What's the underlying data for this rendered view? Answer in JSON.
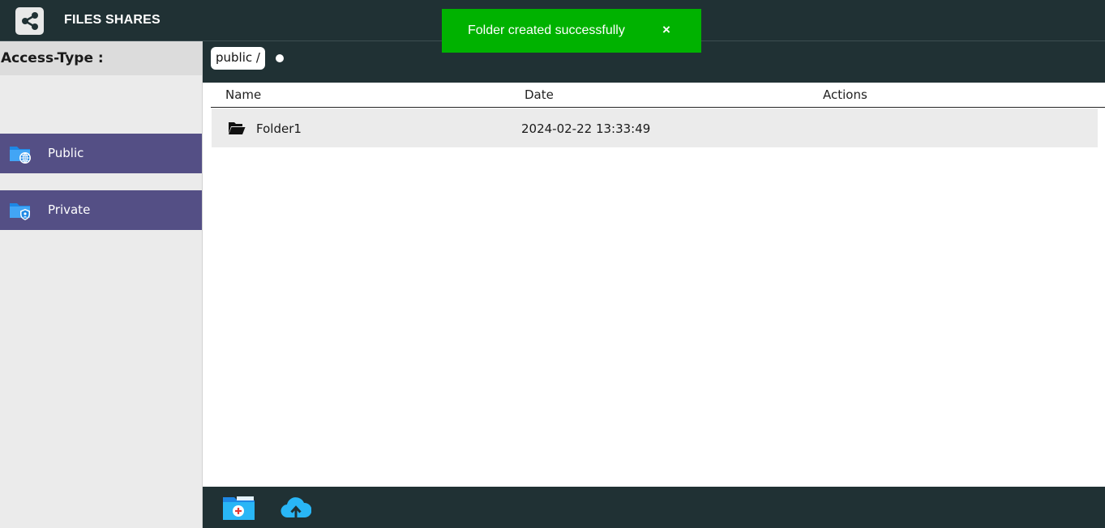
{
  "app": {
    "title": "FILES SHARES",
    "logo_icon": "share-icon"
  },
  "toast": {
    "message": "Folder created successfully",
    "close": "×",
    "color": "#00b200"
  },
  "sidebar": {
    "header": "Access-Type :",
    "items": [
      {
        "label": "Public",
        "icon": "folder-globe-icon"
      },
      {
        "label": "Private",
        "icon": "folder-lock-icon"
      }
    ],
    "accent": "#544f85"
  },
  "path": {
    "crumb": "public /"
  },
  "table": {
    "headers": [
      "Name",
      "Date",
      "Actions"
    ],
    "rows": [
      {
        "name": "Folder1",
        "date": "2024-02-22 13:33:49",
        "icon": "folder-open-icon"
      }
    ]
  },
  "footer": {
    "buttons": [
      {
        "icon": "new-folder-icon"
      },
      {
        "icon": "cloud-upload-icon"
      }
    ]
  },
  "colors": {
    "dark": "#203134"
  }
}
